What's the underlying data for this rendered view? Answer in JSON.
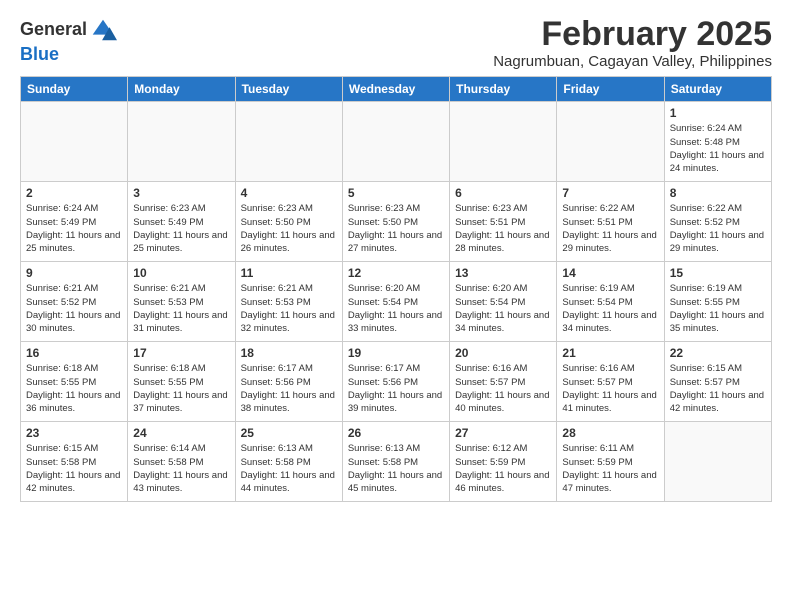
{
  "logo": {
    "general": "General",
    "blue": "Blue"
  },
  "title": "February 2025",
  "subtitle": "Nagrumbuan, Cagayan Valley, Philippines",
  "days_of_week": [
    "Sunday",
    "Monday",
    "Tuesday",
    "Wednesday",
    "Thursday",
    "Friday",
    "Saturday"
  ],
  "weeks": [
    [
      {
        "day": "",
        "info": ""
      },
      {
        "day": "",
        "info": ""
      },
      {
        "day": "",
        "info": ""
      },
      {
        "day": "",
        "info": ""
      },
      {
        "day": "",
        "info": ""
      },
      {
        "day": "",
        "info": ""
      },
      {
        "day": "1",
        "info": "Sunrise: 6:24 AM\nSunset: 5:48 PM\nDaylight: 11 hours and 24 minutes."
      }
    ],
    [
      {
        "day": "2",
        "info": "Sunrise: 6:24 AM\nSunset: 5:49 PM\nDaylight: 11 hours and 25 minutes."
      },
      {
        "day": "3",
        "info": "Sunrise: 6:23 AM\nSunset: 5:49 PM\nDaylight: 11 hours and 25 minutes."
      },
      {
        "day": "4",
        "info": "Sunrise: 6:23 AM\nSunset: 5:50 PM\nDaylight: 11 hours and 26 minutes."
      },
      {
        "day": "5",
        "info": "Sunrise: 6:23 AM\nSunset: 5:50 PM\nDaylight: 11 hours and 27 minutes."
      },
      {
        "day": "6",
        "info": "Sunrise: 6:23 AM\nSunset: 5:51 PM\nDaylight: 11 hours and 28 minutes."
      },
      {
        "day": "7",
        "info": "Sunrise: 6:22 AM\nSunset: 5:51 PM\nDaylight: 11 hours and 29 minutes."
      },
      {
        "day": "8",
        "info": "Sunrise: 6:22 AM\nSunset: 5:52 PM\nDaylight: 11 hours and 29 minutes."
      }
    ],
    [
      {
        "day": "9",
        "info": "Sunrise: 6:21 AM\nSunset: 5:52 PM\nDaylight: 11 hours and 30 minutes."
      },
      {
        "day": "10",
        "info": "Sunrise: 6:21 AM\nSunset: 5:53 PM\nDaylight: 11 hours and 31 minutes."
      },
      {
        "day": "11",
        "info": "Sunrise: 6:21 AM\nSunset: 5:53 PM\nDaylight: 11 hours and 32 minutes."
      },
      {
        "day": "12",
        "info": "Sunrise: 6:20 AM\nSunset: 5:54 PM\nDaylight: 11 hours and 33 minutes."
      },
      {
        "day": "13",
        "info": "Sunrise: 6:20 AM\nSunset: 5:54 PM\nDaylight: 11 hours and 34 minutes."
      },
      {
        "day": "14",
        "info": "Sunrise: 6:19 AM\nSunset: 5:54 PM\nDaylight: 11 hours and 34 minutes."
      },
      {
        "day": "15",
        "info": "Sunrise: 6:19 AM\nSunset: 5:55 PM\nDaylight: 11 hours and 35 minutes."
      }
    ],
    [
      {
        "day": "16",
        "info": "Sunrise: 6:18 AM\nSunset: 5:55 PM\nDaylight: 11 hours and 36 minutes."
      },
      {
        "day": "17",
        "info": "Sunrise: 6:18 AM\nSunset: 5:55 PM\nDaylight: 11 hours and 37 minutes."
      },
      {
        "day": "18",
        "info": "Sunrise: 6:17 AM\nSunset: 5:56 PM\nDaylight: 11 hours and 38 minutes."
      },
      {
        "day": "19",
        "info": "Sunrise: 6:17 AM\nSunset: 5:56 PM\nDaylight: 11 hours and 39 minutes."
      },
      {
        "day": "20",
        "info": "Sunrise: 6:16 AM\nSunset: 5:57 PM\nDaylight: 11 hours and 40 minutes."
      },
      {
        "day": "21",
        "info": "Sunrise: 6:16 AM\nSunset: 5:57 PM\nDaylight: 11 hours and 41 minutes."
      },
      {
        "day": "22",
        "info": "Sunrise: 6:15 AM\nSunset: 5:57 PM\nDaylight: 11 hours and 42 minutes."
      }
    ],
    [
      {
        "day": "23",
        "info": "Sunrise: 6:15 AM\nSunset: 5:58 PM\nDaylight: 11 hours and 42 minutes."
      },
      {
        "day": "24",
        "info": "Sunrise: 6:14 AM\nSunset: 5:58 PM\nDaylight: 11 hours and 43 minutes."
      },
      {
        "day": "25",
        "info": "Sunrise: 6:13 AM\nSunset: 5:58 PM\nDaylight: 11 hours and 44 minutes."
      },
      {
        "day": "26",
        "info": "Sunrise: 6:13 AM\nSunset: 5:58 PM\nDaylight: 11 hours and 45 minutes."
      },
      {
        "day": "27",
        "info": "Sunrise: 6:12 AM\nSunset: 5:59 PM\nDaylight: 11 hours and 46 minutes."
      },
      {
        "day": "28",
        "info": "Sunrise: 6:11 AM\nSunset: 5:59 PM\nDaylight: 11 hours and 47 minutes."
      },
      {
        "day": "",
        "info": ""
      }
    ]
  ]
}
